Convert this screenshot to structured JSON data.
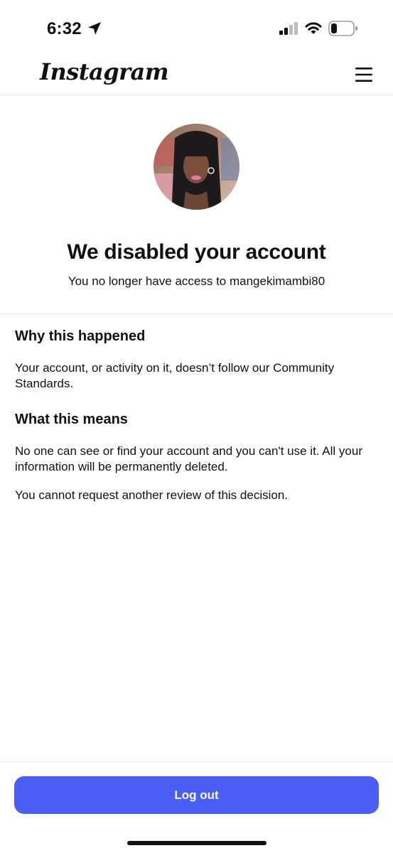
{
  "status_bar": {
    "time": "6:32",
    "icons": [
      "location-arrow-icon",
      "cellular-signal-icon",
      "wifi-icon",
      "battery-icon"
    ]
  },
  "header": {
    "logo": "Instagram",
    "menu_icon": "hamburger-menu-icon"
  },
  "profile": {
    "avatar": "profile-photo",
    "title": "We disabled your account",
    "subtitle": "You no longer have access to mangekimambi80"
  },
  "why": {
    "heading": "Why this happened",
    "text": "Your account, or activity on it, doesn’t follow our Community Standards."
  },
  "means": {
    "heading": "What this means",
    "text": "No one can see or find your account and you can't use it. All your information will be permanently deleted.",
    "note": "You cannot request another review of this decision."
  },
  "footer": {
    "logout_label": "Log out"
  },
  "colors": {
    "primary_button": "#4a5ef5",
    "text": "#111111",
    "background": "#ffffff"
  }
}
